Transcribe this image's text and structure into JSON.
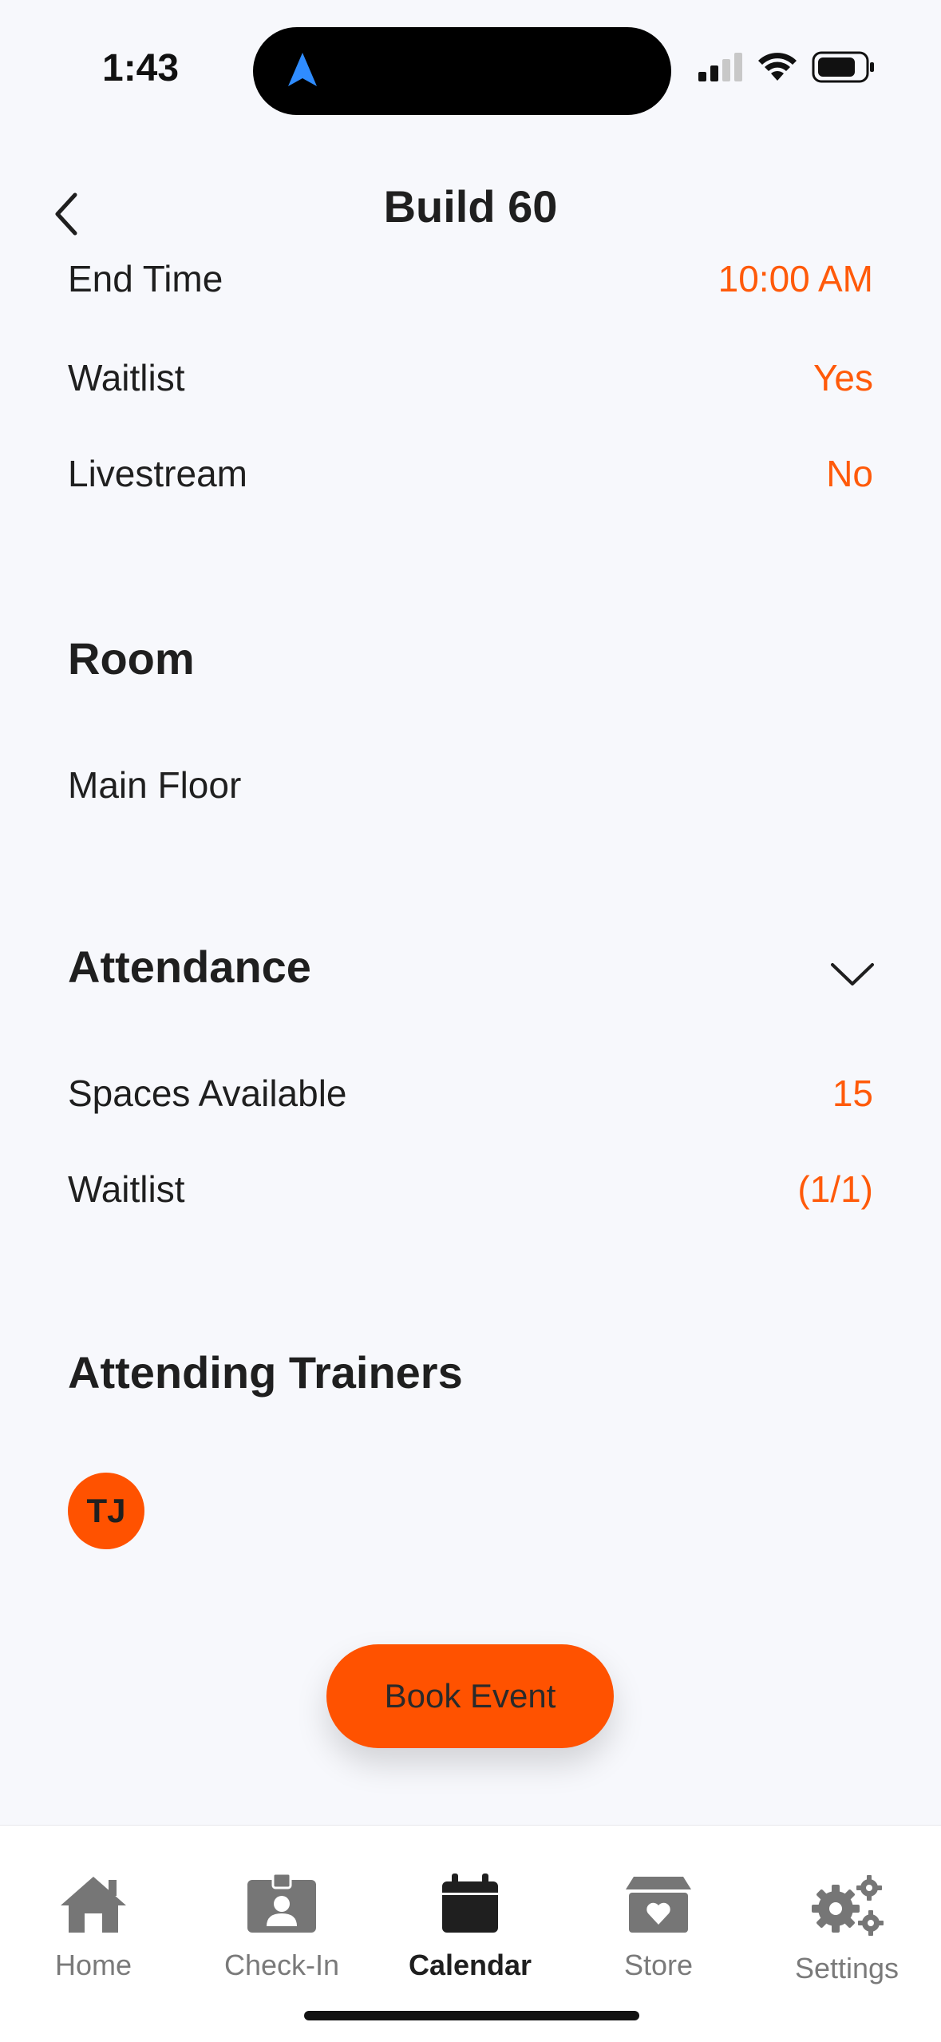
{
  "status_bar": {
    "time": "1:43"
  },
  "header": {
    "title": "Build 60"
  },
  "details": [
    {
      "label": "End Time",
      "value": "10:00 AM"
    },
    {
      "label": "Waitlist",
      "value": "Yes"
    },
    {
      "label": "Livestream",
      "value": "No"
    }
  ],
  "room": {
    "title": "Room",
    "name": "Main Floor"
  },
  "attendance": {
    "title": "Attendance",
    "rows": [
      {
        "label": "Spaces Available",
        "value": "15"
      },
      {
        "label": "Waitlist",
        "value": "(1/1)"
      }
    ]
  },
  "trainers": {
    "title": "Attending Trainers",
    "initials": [
      "TJ"
    ]
  },
  "actions": {
    "book_label": "Book Event"
  },
  "tabbar": {
    "tabs": [
      {
        "label": "Home",
        "icon": "home-icon"
      },
      {
        "label": "Check-In",
        "icon": "badge-icon"
      },
      {
        "label": "Calendar",
        "icon": "calendar-icon",
        "active": true
      },
      {
        "label": "Store",
        "icon": "store-icon"
      },
      {
        "label": "Settings",
        "icon": "gears-icon"
      }
    ]
  },
  "colors": {
    "accent": "#ff5200",
    "value_text": "#ff5a0a",
    "background": "#f7f8fc"
  }
}
